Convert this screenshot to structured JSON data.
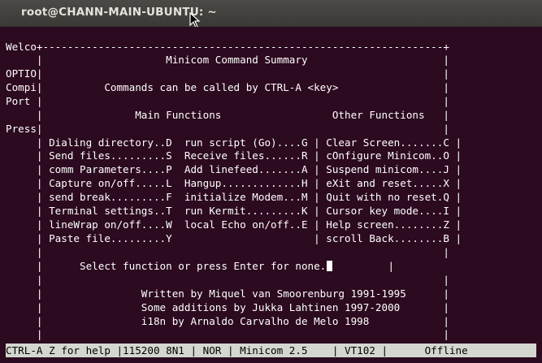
{
  "window": {
    "title": "root@CHANN-MAIN-UBUNTU: ~"
  },
  "terminal": {
    "lines": [
      "Welco+-----------------------------------------------------------------+",
      "     |                    Minicom Command Summary                      |",
      "OPTIO|                                                                 |",
      "Compi|          Commands can be called by CTRL-A <key>                 |",
      "Port |                                                                 |",
      "     |               Main Functions                  Other Functions   |",
      "Press|                                                                 |",
      "     | Dialing directory..D  run script (Go)....G | Clear Screen.......C |",
      "     | Send files.........S  Receive files......R | cOnfigure Minicom..O |",
      "     | comm Parameters....P  Add linefeed.......A | Suspend minicom....J |",
      "     | Capture on/off.....L  Hangup.............H | eXit and reset.....X |",
      "     | send break.........F  initialize Modem...M | Quit with no reset.Q |",
      "     | Terminal settings..T  run Kermit.........K | Cursor key mode....I |",
      "     | lineWrap on/off....W  local Echo on/off..E | Help screen........Z |",
      "     | Paste file.........Y                       | scroll Back........B |",
      "     |                                                                 |",
      "     |      Select function or press Enter for none.",
      "     |                                                                 |",
      "     |                Written by Miquel van Smoorenburg 1991-1995      |",
      "     |                Some additions by Jukka Lahtinen 1997-2000       |",
      "     |                i18n by Arnaldo Carvalho de Melo 1998            |",
      "     |                                                                 |",
      "     +-----------------------------------------------------------------+"
    ],
    "prompt_tail": "         |"
  },
  "statusbar": {
    "text": "CTRL-A Z for help |115200 8N1 | NOR | Minicom 2.5    | VT102 |      Offline"
  }
}
